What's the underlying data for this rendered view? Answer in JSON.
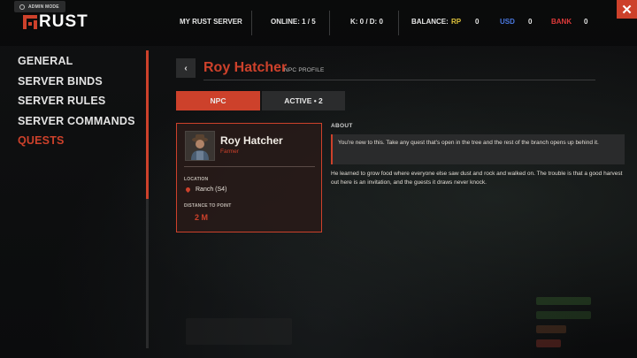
{
  "admin_badge": "ADMIN MODE",
  "logo": "RUST",
  "topbar": {
    "server": "MY RUST SERVER",
    "online": "ONLINE: 1 / 5",
    "kd": "K: 0  / D: 0",
    "balance_label": "BALANCE:",
    "rp_label": "RP",
    "rp_value": "0",
    "usd_label": "USD",
    "usd_value": "0",
    "bank_label": "BANK",
    "bank_value": "0",
    "close": "✕"
  },
  "colors": {
    "accent": "#cd412b",
    "rp": "#e0c43c",
    "usd": "#4a78e0",
    "bank": "#e03a3a"
  },
  "nav": {
    "items": [
      {
        "label": "GENERAL"
      },
      {
        "label": "SERVER BINDS"
      },
      {
        "label": "SERVER RULES"
      },
      {
        "label": "SERVER COMMANDS"
      },
      {
        "label": "QUESTS"
      }
    ],
    "active_index": 4
  },
  "header": {
    "back": "‹",
    "title": "Roy Hatcher",
    "subtitle": "NPC PROFILE"
  },
  "tabs": {
    "npc": "NPC",
    "active": "ACTIVE • 2"
  },
  "card": {
    "avatar_icon": "farmer-portrait",
    "name": "Roy Hatcher",
    "role": "Farmer",
    "location_label": "LOCATION",
    "location_value": "Ranch (S4)",
    "distance_label": "DISTANCE TO POINT",
    "distance_value": "2 M"
  },
  "about": {
    "heading": "ABOUT",
    "note": "You're new to this. Take any quest that's open in the tree and the rest of the branch opens up behind it.",
    "body": "He learned to grow food where everyone else saw dust and rock and walked on. The trouble is that a good harvest out here is an invitation, and the guests it draws never knock."
  }
}
